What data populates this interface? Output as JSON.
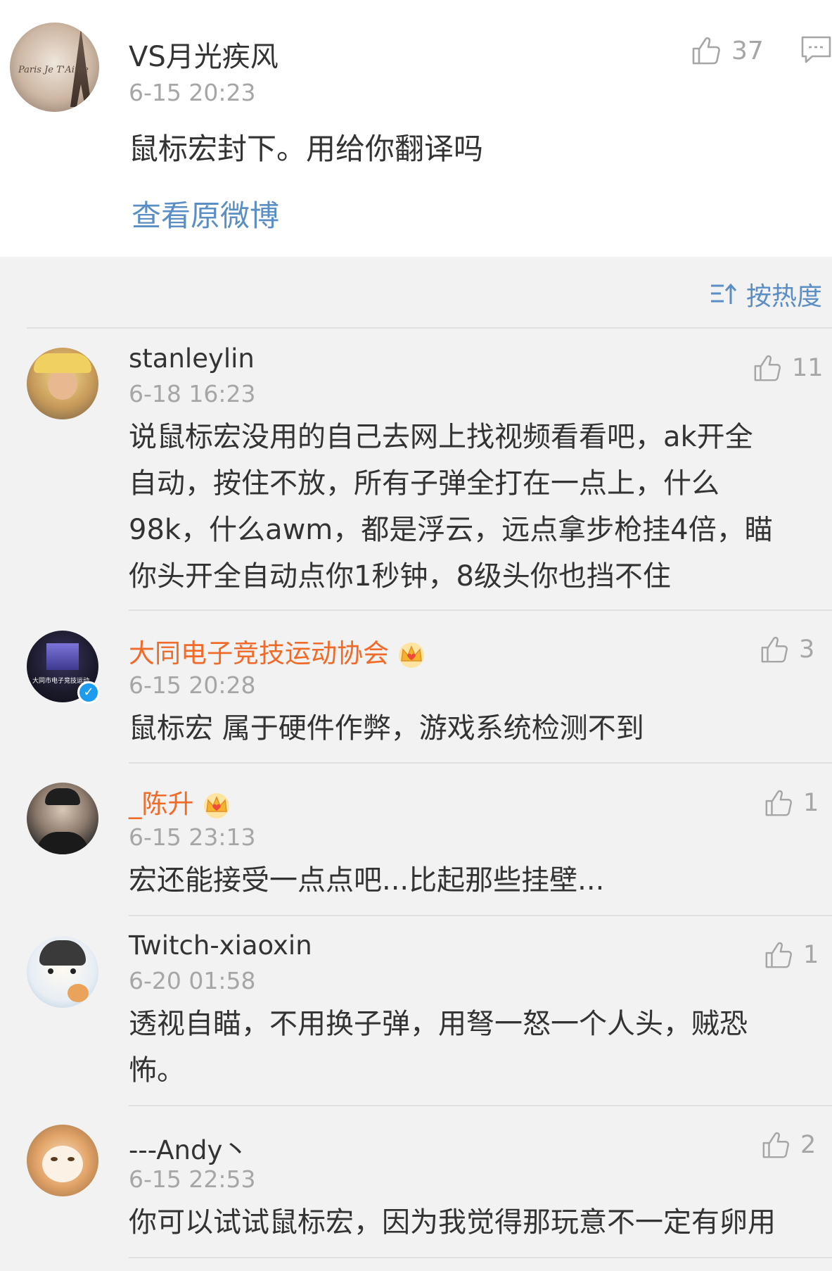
{
  "post": {
    "username": "VS月光疾风",
    "time": "6-15 20:23",
    "text": "鼠标宏封下。用给你翻译吗",
    "link": "查看原微博",
    "likes": "37",
    "avatar_script": "Paris Je T'Aime"
  },
  "sort": {
    "label": "按热度"
  },
  "comments": [
    {
      "username": "stanleylin",
      "time": "6-18 16:23",
      "lines": [
        "说鼠标宏没用的自己去网上找视频看看吧，ak开全",
        "自动，按住不放，所有子弹全打在一点上，什么",
        "98k，什么awm，都是浮云，远点拿步枪挂4倍，瞄",
        "你头开全自动点你1秒钟，8级头你也挡不住"
      ],
      "likes": "11"
    },
    {
      "username": "大同电子竞技运动协会",
      "time": "6-15 20:28",
      "lines": [
        "鼠标宏 属于硬件作弊，游戏系统检测不到"
      ],
      "likes": "3",
      "verified": true,
      "crown": true,
      "avatar_text": "大同市电子竞技运动"
    },
    {
      "username": "_陈升",
      "time": "6-15 23:13",
      "lines": [
        "宏还能接受一点点吧...比起那些挂壁..."
      ],
      "likes": "1",
      "crown": true
    },
    {
      "username": "Twitch-xiaoxin",
      "time": "6-20 01:58",
      "lines": [
        "透视自瞄，不用换子弹，用弩一怒一个人头，贼恐",
        "怖。"
      ],
      "likes": "1"
    },
    {
      "username": "---Andy丶",
      "time": "6-15 22:53",
      "lines": [
        "你可以试试鼠标宏，因为我觉得那玩意不一定有卵用"
      ],
      "likes": "2"
    }
  ],
  "colors": {
    "accent_blue": "#5a8ec4",
    "vip_orange": "#f06b2a",
    "secondary_text": "#a6a6a6",
    "background": "#f2f2f2"
  }
}
